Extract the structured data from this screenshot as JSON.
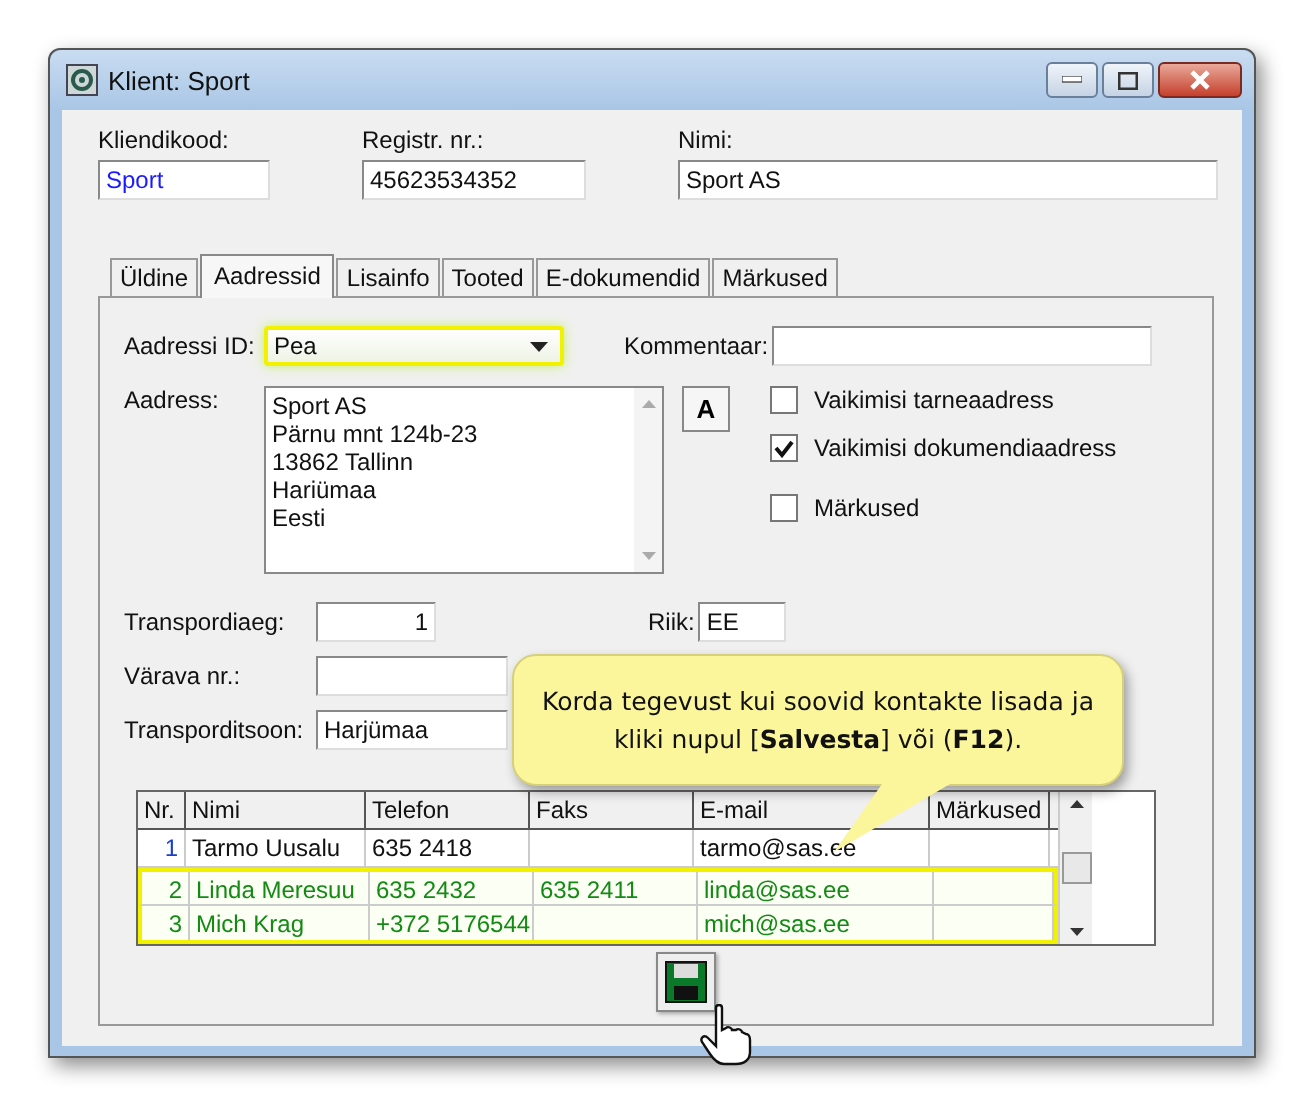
{
  "window": {
    "title": "Klient: Sport"
  },
  "header_fields": [
    {
      "label": "Kliendikood:",
      "value": "Sport",
      "kind": "code"
    },
    {
      "label": "Registr. nr.:",
      "value": "45623534352",
      "kind": "text"
    },
    {
      "label": "Nimi:",
      "value": "Sport AS",
      "kind": "wide"
    }
  ],
  "tabs": [
    {
      "label": "Üldine",
      "selected": false
    },
    {
      "label": "Aadressid",
      "selected": true
    },
    {
      "label": "Lisainfo",
      "selected": false
    },
    {
      "label": "Tooted",
      "selected": false
    },
    {
      "label": "E-dokumendid",
      "selected": false
    },
    {
      "label": "Märkused",
      "selected": false
    }
  ],
  "address_id": {
    "label": "Aadressi ID:",
    "value": "Pea",
    "highlighted": true
  },
  "comment": {
    "label": "Kommentaar:"
  },
  "address": {
    "label": "Aadress:",
    "lines": [
      "Sport AS",
      "Pärnu mnt 124b-23",
      "13862 Tallinn",
      "Hariümaa",
      "Eesti"
    ],
    "button": "A"
  },
  "checkboxes": [
    {
      "label": "Vaikimisi tarneaadress",
      "checked": false
    },
    {
      "label": "Vaikimisi dokumendiaadress",
      "checked": true
    },
    {
      "label": "Märkused",
      "checked": false
    }
  ],
  "transport": [
    {
      "label": "Transpordiaeg:",
      "value": "1",
      "kind": "number"
    },
    {
      "label": "Värava nr.:",
      "kind": "text"
    },
    {
      "label": "Transporditsoon:",
      "value": "Harjümaa",
      "kind": "text"
    }
  ],
  "country": {
    "label": "Riik:",
    "value": "EE"
  },
  "callout": "Korda tegevust kui soovid kontakte lisada ja kliki nupul [**Salvesta**] või (**F12**).",
  "contacts": {
    "columns": [
      "Nr.",
      "Nimi",
      "Telefon",
      "Faks",
      "E-mail",
      "Märkused"
    ],
    "rows": [
      {
        "cells": [
          "1",
          "Tarmo Uusalu",
          "635 2418",
          "",
          "tarmo@sas.ee",
          ""
        ],
        "highlighted": false
      },
      {
        "cells": [
          "2",
          "Linda Meresuu",
          "635 2432",
          "635 2411",
          "linda@sas.ee",
          ""
        ],
        "highlighted": true
      },
      {
        "cells": [
          "3",
          "Mich Krag",
          "+372 5176544",
          "",
          "mich@sas.ee",
          ""
        ],
        "highlighted": true
      }
    ]
  }
}
